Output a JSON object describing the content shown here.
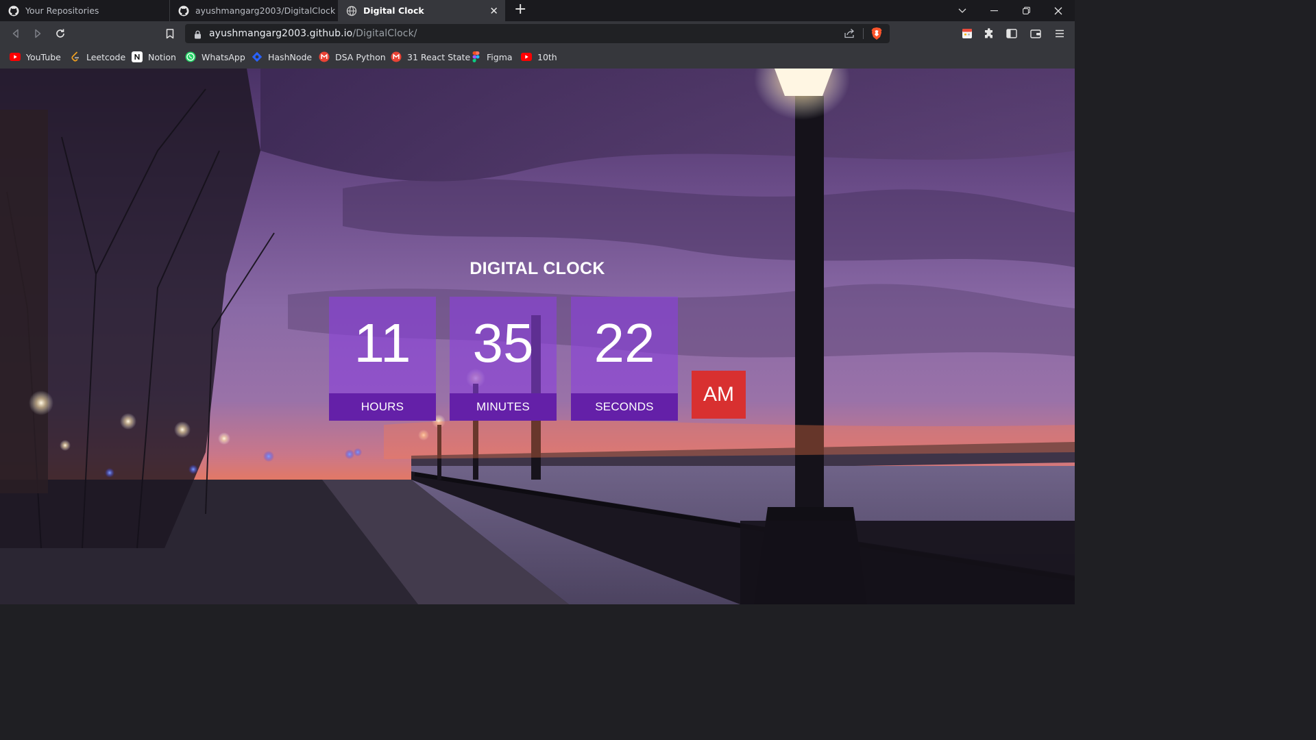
{
  "browser": {
    "tabs": [
      {
        "title": "Your Repositories",
        "favicon": "github-icon",
        "active": false
      },
      {
        "title": "ayushmangarg2003/DigitalClock",
        "favicon": "github-icon",
        "active": false
      },
      {
        "title": "Digital Clock",
        "favicon": "globe-icon",
        "active": true
      }
    ],
    "url": {
      "host": "ayushmangarg2003.github.io",
      "path": "/DigitalClock/"
    },
    "bookmarks": [
      {
        "label": "YouTube",
        "icon": "youtube-icon",
        "color": "#ff0000"
      },
      {
        "label": "Leetcode",
        "icon": "leetcode-icon",
        "color": "#f0a020"
      },
      {
        "label": "Notion",
        "icon": "notion-icon",
        "color": "#ffffff"
      },
      {
        "label": "WhatsApp",
        "icon": "whatsapp-icon",
        "color": "#25d366"
      },
      {
        "label": "HashNode",
        "icon": "hashnode-icon",
        "color": "#2962ff"
      },
      {
        "label": "DSA Python",
        "icon": "gmail-icon",
        "color": "#ea4335"
      },
      {
        "label": "31 React State",
        "icon": "gmail-icon",
        "color": "#ea4335"
      },
      {
        "label": "Figma",
        "icon": "figma-icon",
        "color": "#a259ff"
      },
      {
        "label": "10th",
        "icon": "youtube-icon",
        "color": "#ff0000"
      }
    ]
  },
  "clock": {
    "title": "DIGITAL CLOCK",
    "hours": "11",
    "minutes": "35",
    "seconds": "22",
    "hours_label": "HOURS",
    "minutes_label": "MINUTES",
    "seconds_label": "SECONDS",
    "period": "AM"
  },
  "colors": {
    "unit_bg": "#8a41dc",
    "unit_label_bg": "#6420a8",
    "ampm_bg": "#d83030"
  }
}
